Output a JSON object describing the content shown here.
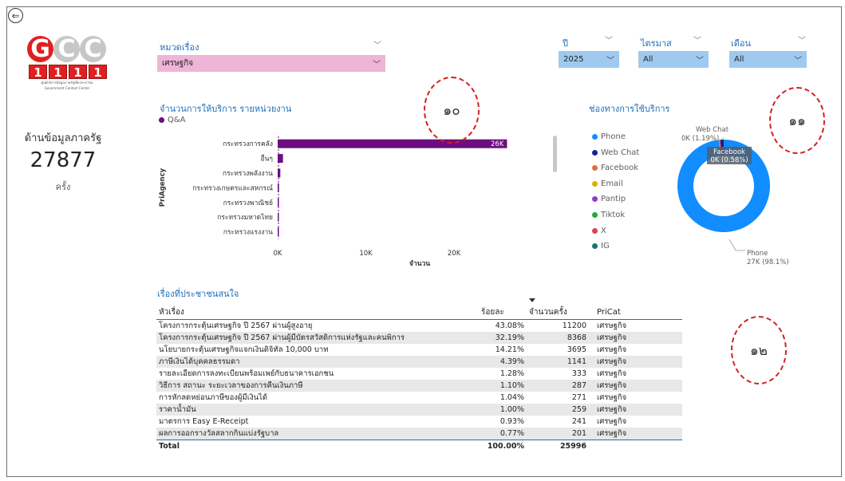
{
  "nav": {
    "back_glyph": "⇐"
  },
  "logo": {
    "letters": [
      "G",
      "C",
      "C"
    ],
    "digits": [
      "1",
      "1",
      "1",
      "1"
    ],
    "subtitle_th": "ศูนย์บริการข้อมูลภาครัฐเพื่อประชาชน",
    "subtitle_en": "Government Contact Center"
  },
  "kpi": {
    "title": "ด้านข้อมูลภาครัฐ",
    "value": "27877",
    "unit": "ครั้ง"
  },
  "filters": {
    "category": {
      "label": "หมวดเรื่อง",
      "value": "เศรษฐกิจ"
    },
    "year": {
      "label": "ปี",
      "value": "2025"
    },
    "quarter": {
      "label": "ไตรมาส",
      "value": "All"
    },
    "month": {
      "label": "เดือน",
      "value": "All"
    }
  },
  "chart_data": [
    {
      "type": "bar",
      "orientation": "horizontal",
      "title": "จำนวนการให้บริการ รายหน่วยงาน",
      "legend": [
        "Q&A"
      ],
      "xlabel": "จำนวน",
      "ylabel": "PriAgency",
      "x_ticks": [
        "0K",
        "10K",
        "20K"
      ],
      "xlim": [
        0,
        27500
      ],
      "categories": [
        "กระทรวงการคลัง",
        "อื่นๆ",
        "กระทรวงพลังงาน",
        "กระทรวงเกษตรและสหกรณ์",
        "กระทรวงพาณิชย์",
        "กระทรวงมหาดไทย",
        "กระทรวงแรงงาน"
      ],
      "values": [
        26000,
        600,
        300,
        150,
        120,
        100,
        80
      ],
      "data_labels": [
        "26K",
        "",
        "",
        "",
        "",
        "",
        ""
      ],
      "color": "#6b0f7e"
    },
    {
      "type": "pie",
      "donut": true,
      "title": "ช่องทางการใช้บริการ",
      "legend": [
        "Phone",
        "Web Chat",
        "Facebook",
        "Email",
        "Pantip",
        "Tiktok",
        "X",
        "IG"
      ],
      "colors": [
        "#118dff",
        "#12239e",
        "#e66c37",
        "#d9b300",
        "#8d3ccf",
        "#1aab40",
        "#d64550",
        "#197278"
      ],
      "values": [
        98.1,
        1.19,
        0.58,
        0,
        0,
        0,
        0,
        0
      ],
      "labels": [
        {
          "name": "Phone",
          "text": "27K (98.1%)"
        },
        {
          "name": "Web Chat",
          "text": "0K (1.19%)"
        },
        {
          "name": "Facebook",
          "text": "0K (0.58%)"
        }
      ]
    }
  ],
  "stamps": [
    "๑๐",
    "๑๑",
    "๑๒"
  ],
  "table": {
    "title": "เรื่องที่ประชาชนสนใจ",
    "columns": [
      "หัวเรื่อง",
      "ร้อยละ",
      "จำนวนครั้ง",
      "PriCat"
    ],
    "rows": [
      [
        "โครงการกระตุ้นเศรษฐกิจ ปี 2567 ผ่านผู้สูงอายุ",
        "43.08%",
        "11200",
        "เศรษฐกิจ"
      ],
      [
        "โครงการกระตุ้นเศรษฐกิจ ปี 2567 ผ่านผู้มีบัตรสวัสดิการแห่งรัฐและคนพิการ",
        "32.19%",
        "8368",
        "เศรษฐกิจ"
      ],
      [
        "นโยบายกระตุ้นเศรษฐกิจแจกเงินดิจิทัล 10,000 บาท",
        "14.21%",
        "3695",
        "เศรษฐกิจ"
      ],
      [
        "ภาษีเงินได้บุคคลธรรมดา",
        "4.39%",
        "1141",
        "เศรษฐกิจ"
      ],
      [
        "รายละเอียดการลงทะเบียนพร้อมเพย์กับธนาคารเอกชน",
        "1.28%",
        "333",
        "เศรษฐกิจ"
      ],
      [
        "วิธีการ สถานะ ระยะเวลาของการคืนเงินภาษี",
        "1.10%",
        "287",
        "เศรษฐกิจ"
      ],
      [
        "การหักลดหย่อนภาษีของผู้มีเงินได้",
        "1.04%",
        "271",
        "เศรษฐกิจ"
      ],
      [
        "ราคาน้ำมัน",
        "1.00%",
        "259",
        "เศรษฐกิจ"
      ],
      [
        "มาตรการ Easy E-Receipt",
        "0.93%",
        "241",
        "เศรษฐกิจ"
      ],
      [
        "ผลการออกรางวัลสลากกินแบ่งรัฐบาล",
        "0.77%",
        "201",
        "เศรษฐกิจ"
      ]
    ],
    "total": {
      "label": "Total",
      "percent": "100.00%",
      "count": "25996"
    }
  }
}
